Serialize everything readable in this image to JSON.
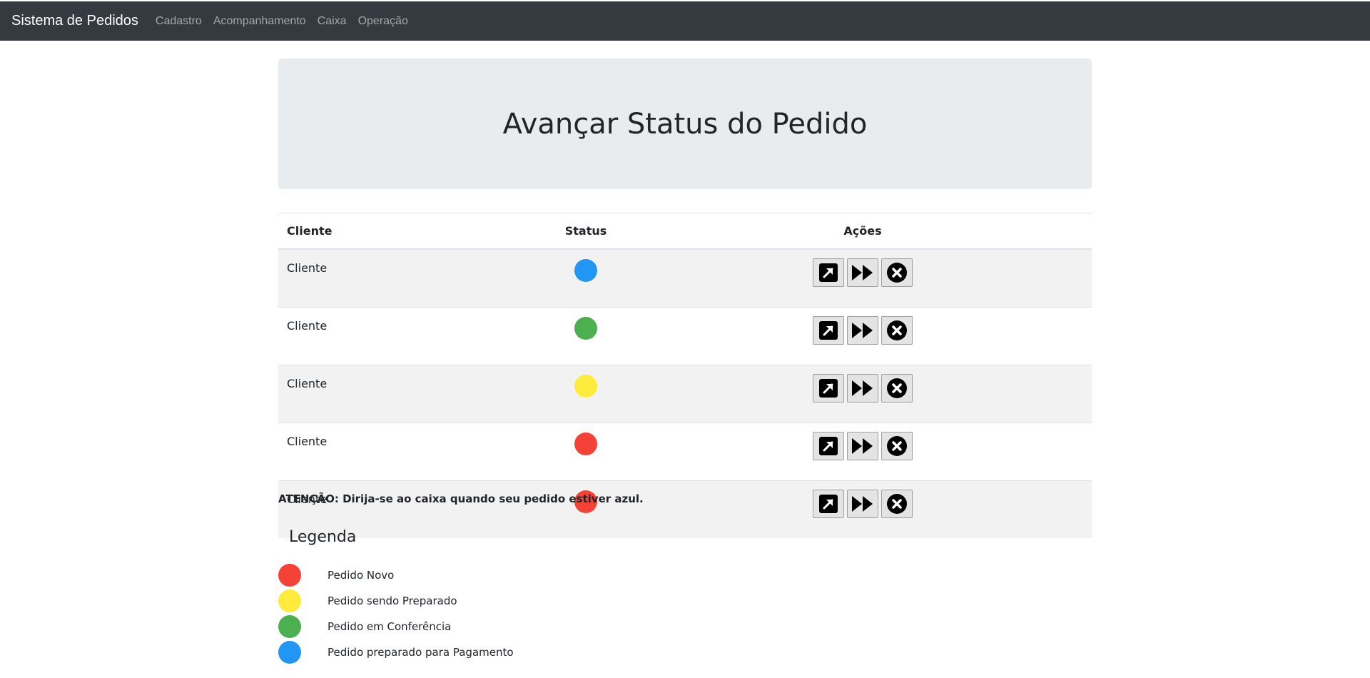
{
  "navbar": {
    "brand": "Sistema de Pedidos",
    "links": [
      "Cadastro",
      "Acompanhamento",
      "Caixa",
      "Operação"
    ]
  },
  "page": {
    "title": "Avançar Status do Pedido"
  },
  "table": {
    "headers": {
      "cliente": "Cliente",
      "status": "Status",
      "acoes": "Ações"
    },
    "rows": [
      {
        "cliente": "Cliente",
        "status_color": "#2196f3"
      },
      {
        "cliente": "Cliente",
        "status_color": "#4caf50"
      },
      {
        "cliente": "Cliente",
        "status_color": "#ffeb3b"
      },
      {
        "cliente": "Cliente",
        "status_color": "#f44336"
      },
      {
        "cliente": "Cliente",
        "status_color": "#f44336"
      }
    ],
    "action_icons": [
      "open-external-icon",
      "fast-forward-icon",
      "cancel-circle-icon"
    ]
  },
  "attention": "ATENÇÃO: Dirija-se ao caixa quando seu pedido estiver azul.",
  "legend": {
    "title": "Legenda",
    "items": [
      {
        "label": "Pedido Novo",
        "color": "#f44336"
      },
      {
        "label": "Pedido sendo Preparado",
        "color": "#ffeb3b"
      },
      {
        "label": "Pedido em Conferência",
        "color": "#4caf50"
      },
      {
        "label": "Pedido preparado para Pagamento",
        "color": "#2196f3"
      }
    ]
  }
}
